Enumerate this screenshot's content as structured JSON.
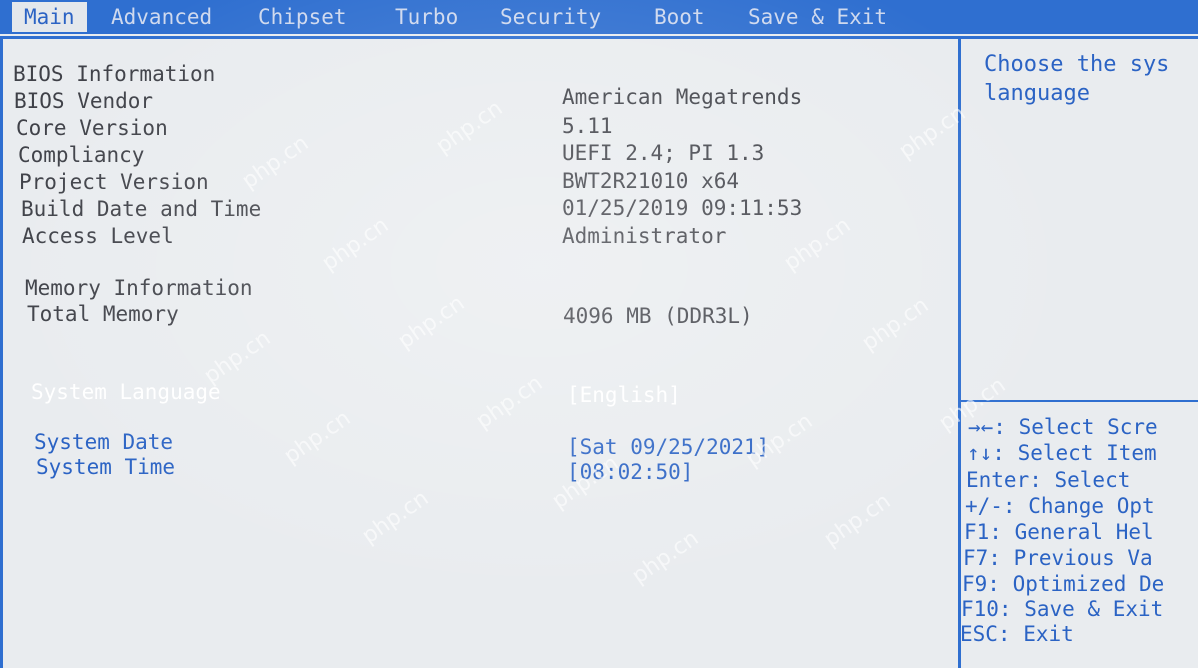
{
  "menu": {
    "tabs": [
      {
        "label": "Main"
      },
      {
        "label": "Advanced"
      },
      {
        "label": "Chipset"
      },
      {
        "label": "Turbo"
      },
      {
        "label": "Security"
      },
      {
        "label": "Boot"
      },
      {
        "label": "Save & Exit"
      }
    ],
    "active": "Main"
  },
  "info": {
    "bios_section": "BIOS Information",
    "bios_vendor_label": "BIOS Vendor",
    "bios_vendor_value": "American Megatrends",
    "core_version_label": "Core Version",
    "core_version_value": "5.11",
    "compliancy_label": "Compliancy",
    "compliancy_value": "UEFI 2.4; PI 1.3",
    "project_version_label": "Project Version",
    "project_version_value": "BWT2R21010 x64",
    "build_date_label": "Build Date and Time",
    "build_date_value": "01/25/2019 09:11:53",
    "access_level_label": "Access Level",
    "access_level_value": "Administrator",
    "memory_section": "Memory Information",
    "total_memory_label": "Total Memory",
    "total_memory_value": "4096 MB (DDR3L)"
  },
  "settings": {
    "language_label": "System Language",
    "language_value": "[English]",
    "date_label": "System Date",
    "date_value": "[Sat 09/25/2021]",
    "time_label": "System Time",
    "time_value": "[08:02:50]"
  },
  "help": {
    "line1": "Choose the sys",
    "line2": "language"
  },
  "keys": [
    {
      "text": "→←: Select Scre"
    },
    {
      "text": "↑↓: Select Item"
    },
    {
      "text": "Enter: Select"
    },
    {
      "text": "+/-: Change Opt"
    },
    {
      "text": "F1: General Hel"
    },
    {
      "text": "F7: Previous Va"
    },
    {
      "text": "F9: Optimized De"
    },
    {
      "text": "F10: Save & Exit"
    },
    {
      "text": "ESC: Exit"
    }
  ],
  "watermark": "php.cn",
  "colors": {
    "accent": "#2f6fd0",
    "background": "#e9ecef",
    "text": "#3f4148",
    "highlight": "#2b63c4"
  }
}
